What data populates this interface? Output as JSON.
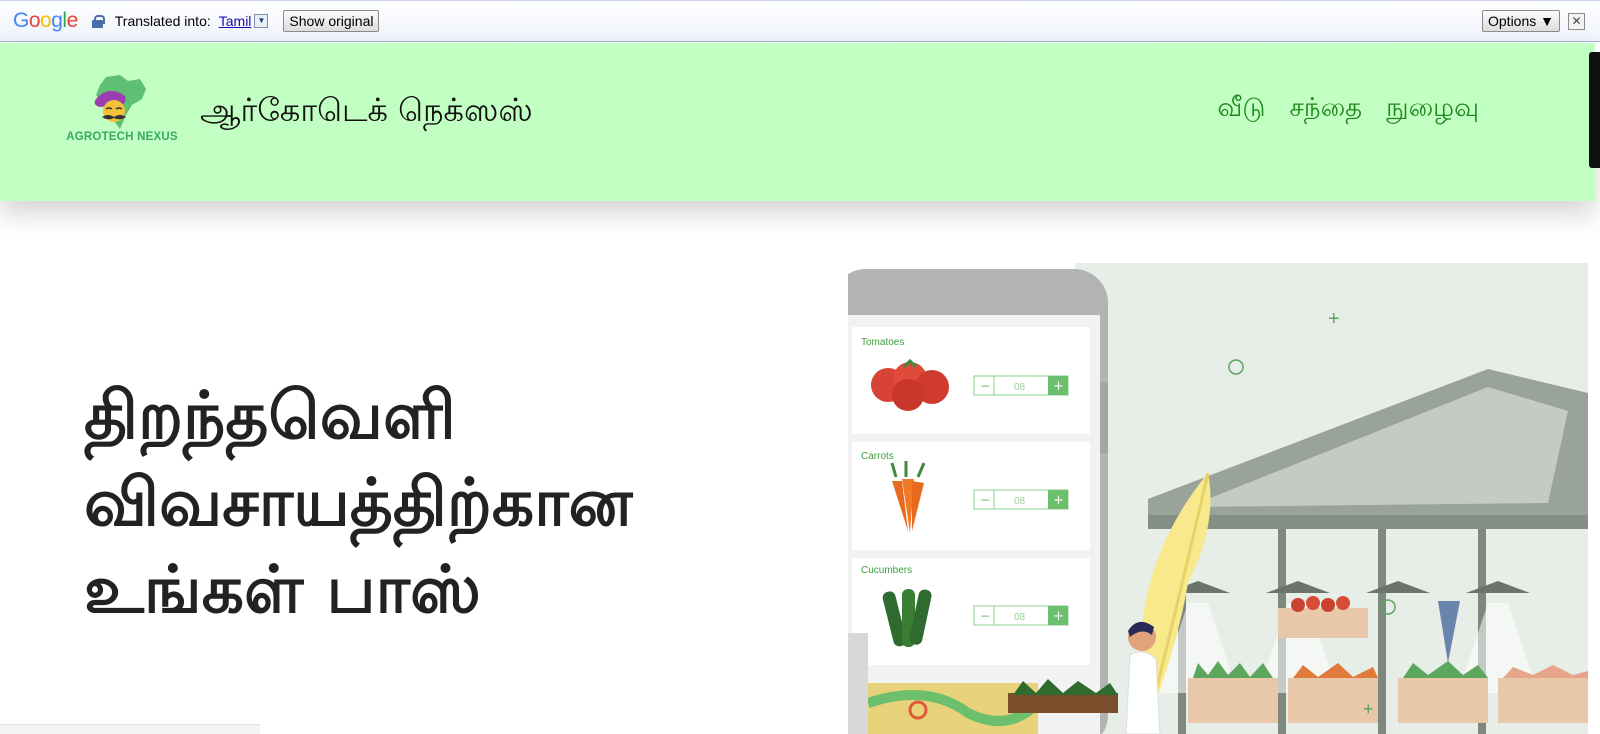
{
  "translate_bar": {
    "logo": "Google",
    "translated_into_label": "Translated into:",
    "language": "Tamil",
    "show_original_label": "Show original",
    "options_label": "Options ▼",
    "close_label": "✕"
  },
  "header": {
    "logo_text": "AGROTECH NEXUS",
    "brand_name": "ஆர்கோடெக் நெக்ஸஸ்",
    "nav": {
      "home": "வீடு",
      "market": "சந்தை",
      "login": "நுழைவு"
    }
  },
  "hero": {
    "title_line1": "திறந்தவெளி",
    "title_line2": "விவசாயத்திற்கான",
    "title_line3": "உங்கள் பாஸ்"
  },
  "illustration": {
    "products": [
      {
        "name": "Tomatoes",
        "qty": "08"
      },
      {
        "name": "Carrots",
        "qty": "08"
      },
      {
        "name": "Cucumbers",
        "qty": "08"
      }
    ],
    "minus": "−",
    "plus": "+"
  },
  "colors": {
    "header_bg": "#c2ffc2",
    "nav_link": "#1e8a1e",
    "accent_green": "#6cbf6c"
  }
}
